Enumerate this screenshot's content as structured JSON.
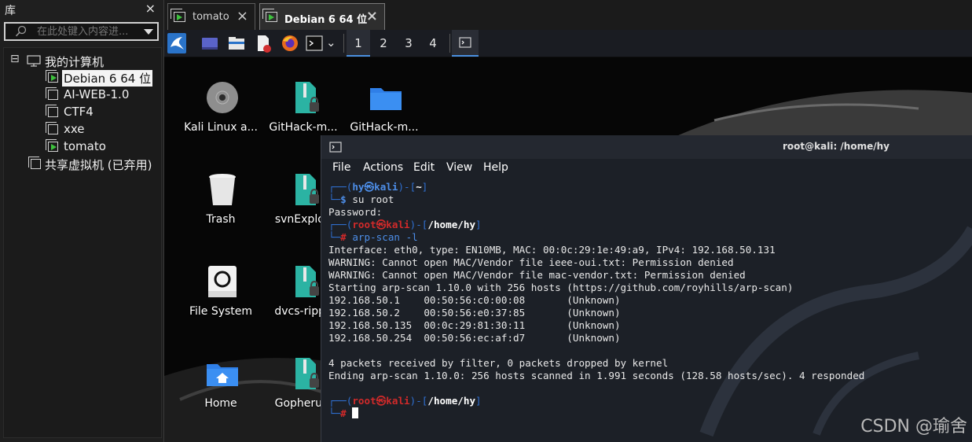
{
  "library": {
    "title": "库",
    "close": "×",
    "search_placeholder": "在此处键入内容进...",
    "tree": {
      "root_toggle": "⊟",
      "root_label": "我的计算机",
      "vms": [
        {
          "label": "Debian 6 64 位",
          "running": true,
          "selected": true
        },
        {
          "label": "AI-WEB-1.0",
          "running": false
        },
        {
          "label": "CTF4",
          "running": false
        },
        {
          "label": "xxe",
          "running": false
        },
        {
          "label": "tomato",
          "running": true
        }
      ],
      "shared_label": "共享虚拟机 (已弃用)"
    }
  },
  "tabs": [
    {
      "label": "tomato",
      "close": "×"
    },
    {
      "label": "Debian 6 64 位",
      "close": "×",
      "active": true
    }
  ],
  "kali_panel": {
    "workspaces": [
      "1",
      "2",
      "3",
      "4"
    ],
    "active_workspace": "1",
    "icons": [
      "kali-menu-icon",
      "desktop-icon",
      "file-manager-icon",
      "text-editor-icon",
      "firefox-icon",
      "terminal-icon",
      "terminal-window-icon"
    ],
    "dropdown_glyph": "⌄"
  },
  "desktop_icons": [
    {
      "label": "Kali Linux a...",
      "icon": "disc-icon"
    },
    {
      "label": "GitHack-m...",
      "icon": "zip-locked-icon"
    },
    {
      "label": "GitHack-m...",
      "icon": "folder-icon"
    },
    {
      "label": "Trash",
      "icon": "trash-icon"
    },
    {
      "label": "svnExploit",
      "icon": "zip-locked-icon"
    },
    {
      "label": "File System",
      "icon": "drive-icon"
    },
    {
      "label": "dvcs-rippe",
      "icon": "zip-locked-icon"
    },
    {
      "label": "Home",
      "icon": "home-folder-icon"
    },
    {
      "label": "Gopherus-",
      "icon": "zip-locked-icon"
    }
  ],
  "terminal": {
    "title": "root@kali: /home/hy",
    "menu": [
      "File",
      "Actions",
      "Edit",
      "View",
      "Help"
    ],
    "prompt1": {
      "user": "hy",
      "at": "㉿",
      "host": "kali",
      "dir": "~",
      "cmd": "su root"
    },
    "password_line": "Password:",
    "prompt2": {
      "user": "root",
      "at": "㉿",
      "host": "kali",
      "dir": "/home/hy",
      "cmd": "arp-scan -l"
    },
    "output": [
      "Interface: eth0, type: EN10MB, MAC: 00:0c:29:1e:49:a9, IPv4: 192.168.50.131",
      "WARNING: Cannot open MAC/Vendor file ieee-oui.txt: Permission denied",
      "WARNING: Cannot open MAC/Vendor file mac-vendor.txt: Permission denied",
      "Starting arp-scan 1.10.0 with 256 hosts (https://github.com/royhills/arp-scan)",
      "192.168.50.1    00:50:56:c0:00:08       (Unknown)",
      "192.168.50.2    00:50:56:e0:37:85       (Unknown)",
      "192.168.50.135  00:0c:29:81:30:11       (Unknown)",
      "192.168.50.254  00:50:56:ec:af:d7       (Unknown)",
      "",
      "4 packets received by filter, 0 packets dropped by kernel",
      "Ending arp-scan 1.10.0: 256 hosts scanned in 1.991 seconds (128.58 hosts/sec). 4 responded"
    ],
    "prompt3": {
      "user": "root",
      "at": "㉿",
      "host": "kali",
      "dir": "/home/hy",
      "hash": "#"
    }
  },
  "watermark": "CSDN @瑜舍",
  "colors": {
    "kali_blue": "#2f6fd0",
    "root_red": "#d12a2a",
    "running_green": "#3ec23e",
    "terminal_bg": "#1c2027"
  }
}
